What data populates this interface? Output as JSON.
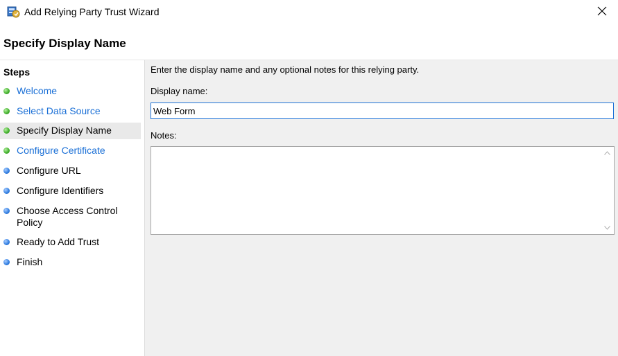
{
  "window": {
    "title": "Add Relying Party Trust Wizard",
    "icon": "adfs-wizard-icon",
    "close_icon": "close-icon"
  },
  "header": {
    "page_title": "Specify Display Name"
  },
  "steps": {
    "title": "Steps",
    "items": [
      {
        "label": "Welcome",
        "status": "completed",
        "link": true
      },
      {
        "label": "Select Data Source",
        "status": "completed",
        "link": true
      },
      {
        "label": "Specify Display Name",
        "status": "current",
        "link": false
      },
      {
        "label": "Configure Certificate",
        "status": "completed",
        "link": true
      },
      {
        "label": "Configure URL",
        "status": "pending",
        "link": false
      },
      {
        "label": "Configure Identifiers",
        "status": "pending",
        "link": false
      },
      {
        "label": "Choose Access Control\nPolicy",
        "status": "pending",
        "link": false
      },
      {
        "label": "Ready to Add Trust",
        "status": "pending",
        "link": false
      },
      {
        "label": "Finish",
        "status": "pending",
        "link": false
      }
    ]
  },
  "main": {
    "instruction": "Enter the display name and any optional notes for this relying party.",
    "display_name_label": "Display name:",
    "display_name_value": "Web Form",
    "notes_label": "Notes:",
    "notes_value": ""
  },
  "colors": {
    "link": "#1a6fd6",
    "completed_dot": "#3fae2a",
    "pending_dot": "#2f7de0",
    "content_bg": "#f0f0f0"
  }
}
